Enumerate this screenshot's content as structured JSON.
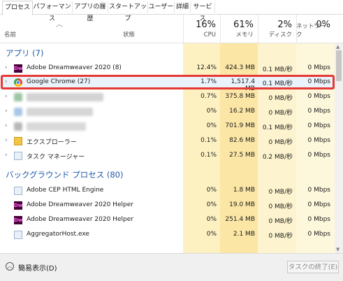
{
  "tabs": [
    "プロセス",
    "パフォーマンス",
    "アプリの履歴",
    "スタートアップ",
    "ユーザー",
    "詳細",
    "サービス"
  ],
  "header": {
    "name": "名前",
    "status": "状態",
    "cpu_pct": "16%",
    "cpu": "CPU",
    "mem_pct": "61%",
    "mem": "メモリ",
    "disk_pct": "2%",
    "disk": "ディスク",
    "net_pct": "0%",
    "net": "ネットワーク"
  },
  "groups": {
    "apps": "アプリ (7)",
    "background": "バックグラウンド プロセス (80)"
  },
  "apps": [
    {
      "name": "Adobe Dreamweaver 2020 (8)",
      "icon": "dreamweaver-icon",
      "cpu": "12.4%",
      "mem": "424.3 MB",
      "disk": "0.1 MB/秒",
      "net": "0 Mbps"
    },
    {
      "name": "Google Chrome (27)",
      "icon": "chrome-icon",
      "cpu": "1.7%",
      "mem": "1,517.4 MB",
      "disk": "0.1 MB/秒",
      "net": "0 Mbps"
    },
    {
      "name": "",
      "icon": "blurred-icon",
      "cpu": "0.7%",
      "mem": "375.8 MB",
      "disk": "0 MB/秒",
      "net": "0 Mbps"
    },
    {
      "name": "",
      "icon": "blurred-icon",
      "cpu": "0%",
      "mem": "16.2 MB",
      "disk": "0 MB/秒",
      "net": "0 Mbps"
    },
    {
      "name": "",
      "icon": "blurred-icon",
      "cpu": "0%",
      "mem": "701.9 MB",
      "disk": "0.1 MB/秒",
      "net": "0 Mbps"
    },
    {
      "name": "エクスプローラー",
      "icon": "explorer-icon",
      "cpu": "0.1%",
      "mem": "82.6 MB",
      "disk": "0 MB/秒",
      "net": "0 Mbps"
    },
    {
      "name": "タスク マネージャー",
      "icon": "taskmanager-icon",
      "cpu": "0.1%",
      "mem": "27.5 MB",
      "disk": "0.2 MB/秒",
      "net": "0 Mbps"
    }
  ],
  "background": [
    {
      "name": "Adobe CEP HTML Engine",
      "icon": "cep-icon",
      "cpu": "0%",
      "mem": "1.8 MB",
      "disk": "0 MB/秒",
      "net": "0 Mbps"
    },
    {
      "name": "Adobe Dreamweaver 2020 Helper",
      "icon": "dreamweaver-icon",
      "cpu": "0%",
      "mem": "19.0 MB",
      "disk": "0 MB/秒",
      "net": "0 Mbps"
    },
    {
      "name": "Adobe Dreamweaver 2020 Helper",
      "icon": "dreamweaver-icon",
      "cpu": "0%",
      "mem": "251.4 MB",
      "disk": "0 MB/秒",
      "net": "0 Mbps"
    },
    {
      "name": "AggregatorHost.exe",
      "icon": "app-icon",
      "cpu": "0%",
      "mem": "2.1 MB",
      "disk": "0 MB/秒",
      "net": "0 Mbps"
    }
  ],
  "footer": {
    "fewer_details": "簡易表示(D)",
    "end_task": "タスクの終了(E)"
  },
  "colors": {
    "highlight": "#e53935",
    "group_title": "#1e5aa8",
    "cpu_col": "#fdf1c2",
    "mem_col": "#fbe6a6",
    "disk_col": "#fdf4cf",
    "net_col": "#fdf7db"
  }
}
